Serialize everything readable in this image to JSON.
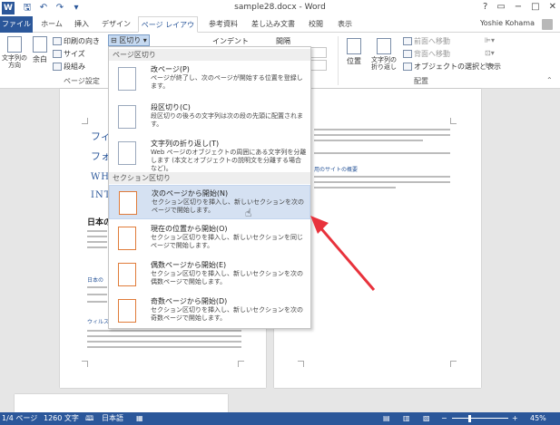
{
  "titlebar": {
    "app_icon": "W",
    "title": "sample28.docx - Word",
    "qat_icons": [
      "save-icon",
      "undo-icon",
      "redo-icon",
      "customize-icon"
    ],
    "controls": [
      "?",
      "▭",
      "−",
      "□",
      "✕"
    ]
  },
  "tabs": {
    "file": "ファイル",
    "items": [
      "ホーム",
      "挿入",
      "デザイン",
      "ページ レイアウト",
      "参考資料",
      "差し込み文書",
      "校閲",
      "表示"
    ],
    "active": "ページ レイアウト",
    "user": "Yoshie Kohama"
  },
  "ribbon": {
    "text_direction": "文字列の\n方向",
    "margins": "余白",
    "orientation": "印刷の向き",
    "size": "サイズ",
    "columns": "段組み",
    "breaks": "区切り",
    "page_setup_label": "ページ設定",
    "indent": "インデント",
    "spacing": "間隔",
    "position": "位置",
    "wrap_text": "文字列の\n折り返し",
    "bring_forward": "前面へ移動",
    "send_backward": "背面へ移動",
    "selection_pane": "オブジェクトの選択と表示",
    "arrange_label": "配置"
  },
  "menu": {
    "section_page": "ページ区切り",
    "section_section": "セクション区切り",
    "items": [
      {
        "title": "改ページ(P)",
        "desc": "ページが終了し、次のページが開始する位置を登録します。"
      },
      {
        "title": "段区切り(C)",
        "desc": "段区切りの後ろの文字列は次の段の先頭に配置されます。"
      },
      {
        "title": "文字列の折り返し(T)",
        "desc": "Web ページのオブジェクトの周囲にある文字列を分離します (本文とオブジェクトの説明文を分離する場合など)。"
      },
      {
        "title": "次のページから開始(N)",
        "desc": "セクション区切りを挿入し、新しいセクションを次のページで開始します。"
      },
      {
        "title": "現在の位置から開始(O)",
        "desc": "セクション区切りを挿入し、新しいセクションを同じページで開始します。"
      },
      {
        "title": "偶数ページから開始(E)",
        "desc": "セクション区切りを挿入し、新しいセクションを次の偶数ページで開始します。"
      },
      {
        "title": "奇数ページから開始(D)",
        "desc": "セクション区切りを挿入し、新しいセクションを次の奇数ページで開始します。"
      }
    ]
  },
  "document": {
    "left_heading_1": "フィ",
    "left_heading_2": "フォ",
    "left_heading_3": "WHI",
    "left_heading_4": "INTI",
    "left_heading_5": "日本の",
    "left_sub_1": "日本の",
    "left_sub_2": "ウィルス",
    "right_heading": "用のサイトの概要"
  },
  "statusbar": {
    "page": "1/4 ページ",
    "words": "1260 文字",
    "language": "日本語",
    "zoom": "45%"
  },
  "colors": {
    "accent": "#2b579a",
    "arrow": "#e8323c",
    "hover": "#d5e1f2"
  }
}
